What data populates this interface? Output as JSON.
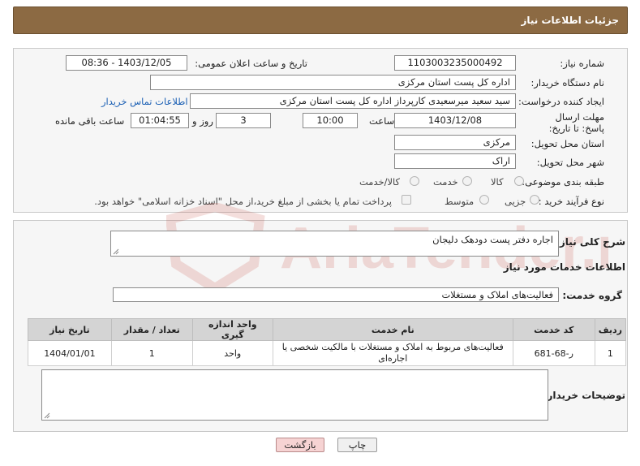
{
  "header": {
    "title": "جزئیات اطلاعات نیاز"
  },
  "form": {
    "need_number_label": "شماره نیاز:",
    "need_number": "1103003235000492",
    "announce_label": "تاریخ و ساعت اعلان عمومی:",
    "announce_value": "1403/12/05 - 08:36",
    "buyer_org_label": "نام دستگاه خریدار:",
    "buyer_org": "اداره کل پست استان مرکزی",
    "requester_label": "ایجاد کننده درخواست:",
    "requester": "سید سعید میرسعیدی کارپرداز اداره کل پست استان مرکزی",
    "contact_link": "اطلاعات تماس خریدار",
    "deadline_label": "مهلت ارسال پاسخ: تا تاریخ:",
    "deadline_date": "1403/12/08",
    "time_label": "ساعت",
    "deadline_time": "10:00",
    "days_value": "3",
    "days_label": "روز و",
    "remaining_time": "01:04:55",
    "remaining_label": "ساعت باقی مانده",
    "province_label": "استان محل تحویل:",
    "province": "مرکزی",
    "city_label": "شهر محل تحویل:",
    "city": "اراک",
    "category_label": "طبقه بندی موضوعی:",
    "category_options": [
      "کالا",
      "خدمت",
      "کالا/خدمت"
    ],
    "process_label": "نوع فرآیند خرید :",
    "process_options": [
      "جزیی",
      "متوسط"
    ],
    "payment_note": "پرداخت تمام یا بخشی از مبلغ خرید،از محل \"اسناد خزانه اسلامی\" خواهد بود."
  },
  "details": {
    "summary_label": "شرح کلی نیاز:",
    "summary_value": "اجاره دفتر پست دودهک دلیجان",
    "services_title": "اطلاعات خدمات مورد نیاز",
    "service_group_label": "گروه خدمت:",
    "service_group_value": "فعالیت‌های  املاک و مستغلات"
  },
  "table": {
    "headers": [
      "ردیف",
      "کد خدمت",
      "نام خدمت",
      "واحد اندازه گیری",
      "تعداد / مقدار",
      "تاریخ نیاز"
    ],
    "rows": [
      [
        "1",
        "ر-68-681",
        "فعالیت‌های مربوط به املاک و مستغلات با مالکیت شخصی یا اجاره‌ای",
        "واحد",
        "1",
        "1404/01/01"
      ]
    ]
  },
  "buyer_notes_label": "توضیحات خریدار:",
  "buttons": {
    "print": "چاپ",
    "back": "بازگشت"
  },
  "watermark": {
    "text": "AriaTender.neT",
    "color": "#c0392b"
  }
}
